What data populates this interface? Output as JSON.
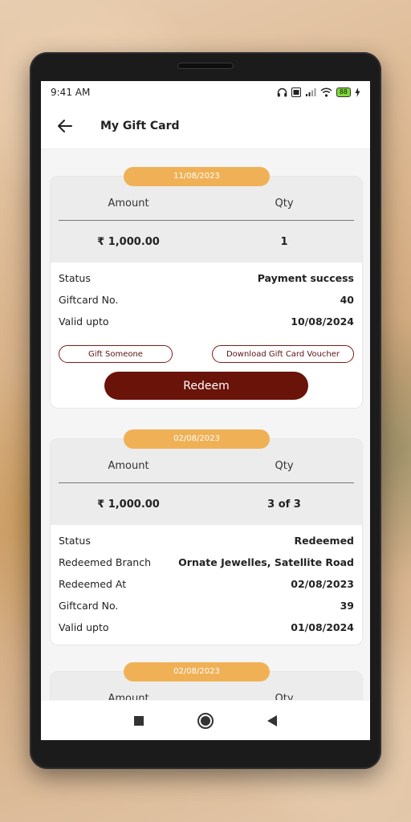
{
  "status_bar": {
    "time": "9:41 AM",
    "icons": [
      "headphones-icon",
      "volte-icon",
      "signal-icon",
      "wifi-icon",
      "battery-icon",
      "charging-icon"
    ],
    "battery_level": "88"
  },
  "app_bar": {
    "title": "My Gift Card",
    "back_icon": "arrow-left-icon"
  },
  "labels": {
    "amount": "Amount",
    "qty": "Qty",
    "status": "Status",
    "giftcard_no": "Giftcard No.",
    "valid_upto": "Valid upto",
    "redeemed_branch": "Redeemed Branch",
    "redeemed_at": "Redeemed At"
  },
  "cards": [
    {
      "date": "11/08/2023",
      "amount": "₹ 1,000.00",
      "qty": "1",
      "status": "Payment success",
      "giftcard_no": "40",
      "valid_upto": "10/08/2024",
      "gift_button": "Gift Someone",
      "download_button": "Download Gift Card Voucher",
      "redeem_button": "Redeem"
    },
    {
      "date": "02/08/2023",
      "amount": "₹ 1,000.00",
      "qty": "3 of 3",
      "status": "Redeemed",
      "redeemed_branch": "Ornate Jewelles, Satellite Road",
      "redeemed_at": "02/08/2023",
      "giftcard_no": "39",
      "valid_upto": "01/08/2024"
    },
    {
      "date": "02/08/2023"
    }
  ],
  "nav_bar": {
    "icons": [
      "recents-square-icon",
      "home-circle-icon",
      "back-triangle-icon"
    ]
  },
  "colors": {
    "accent_pill": "#f0b156",
    "redeem_button": "#6a1309",
    "outline_button": "#7a1c16"
  }
}
